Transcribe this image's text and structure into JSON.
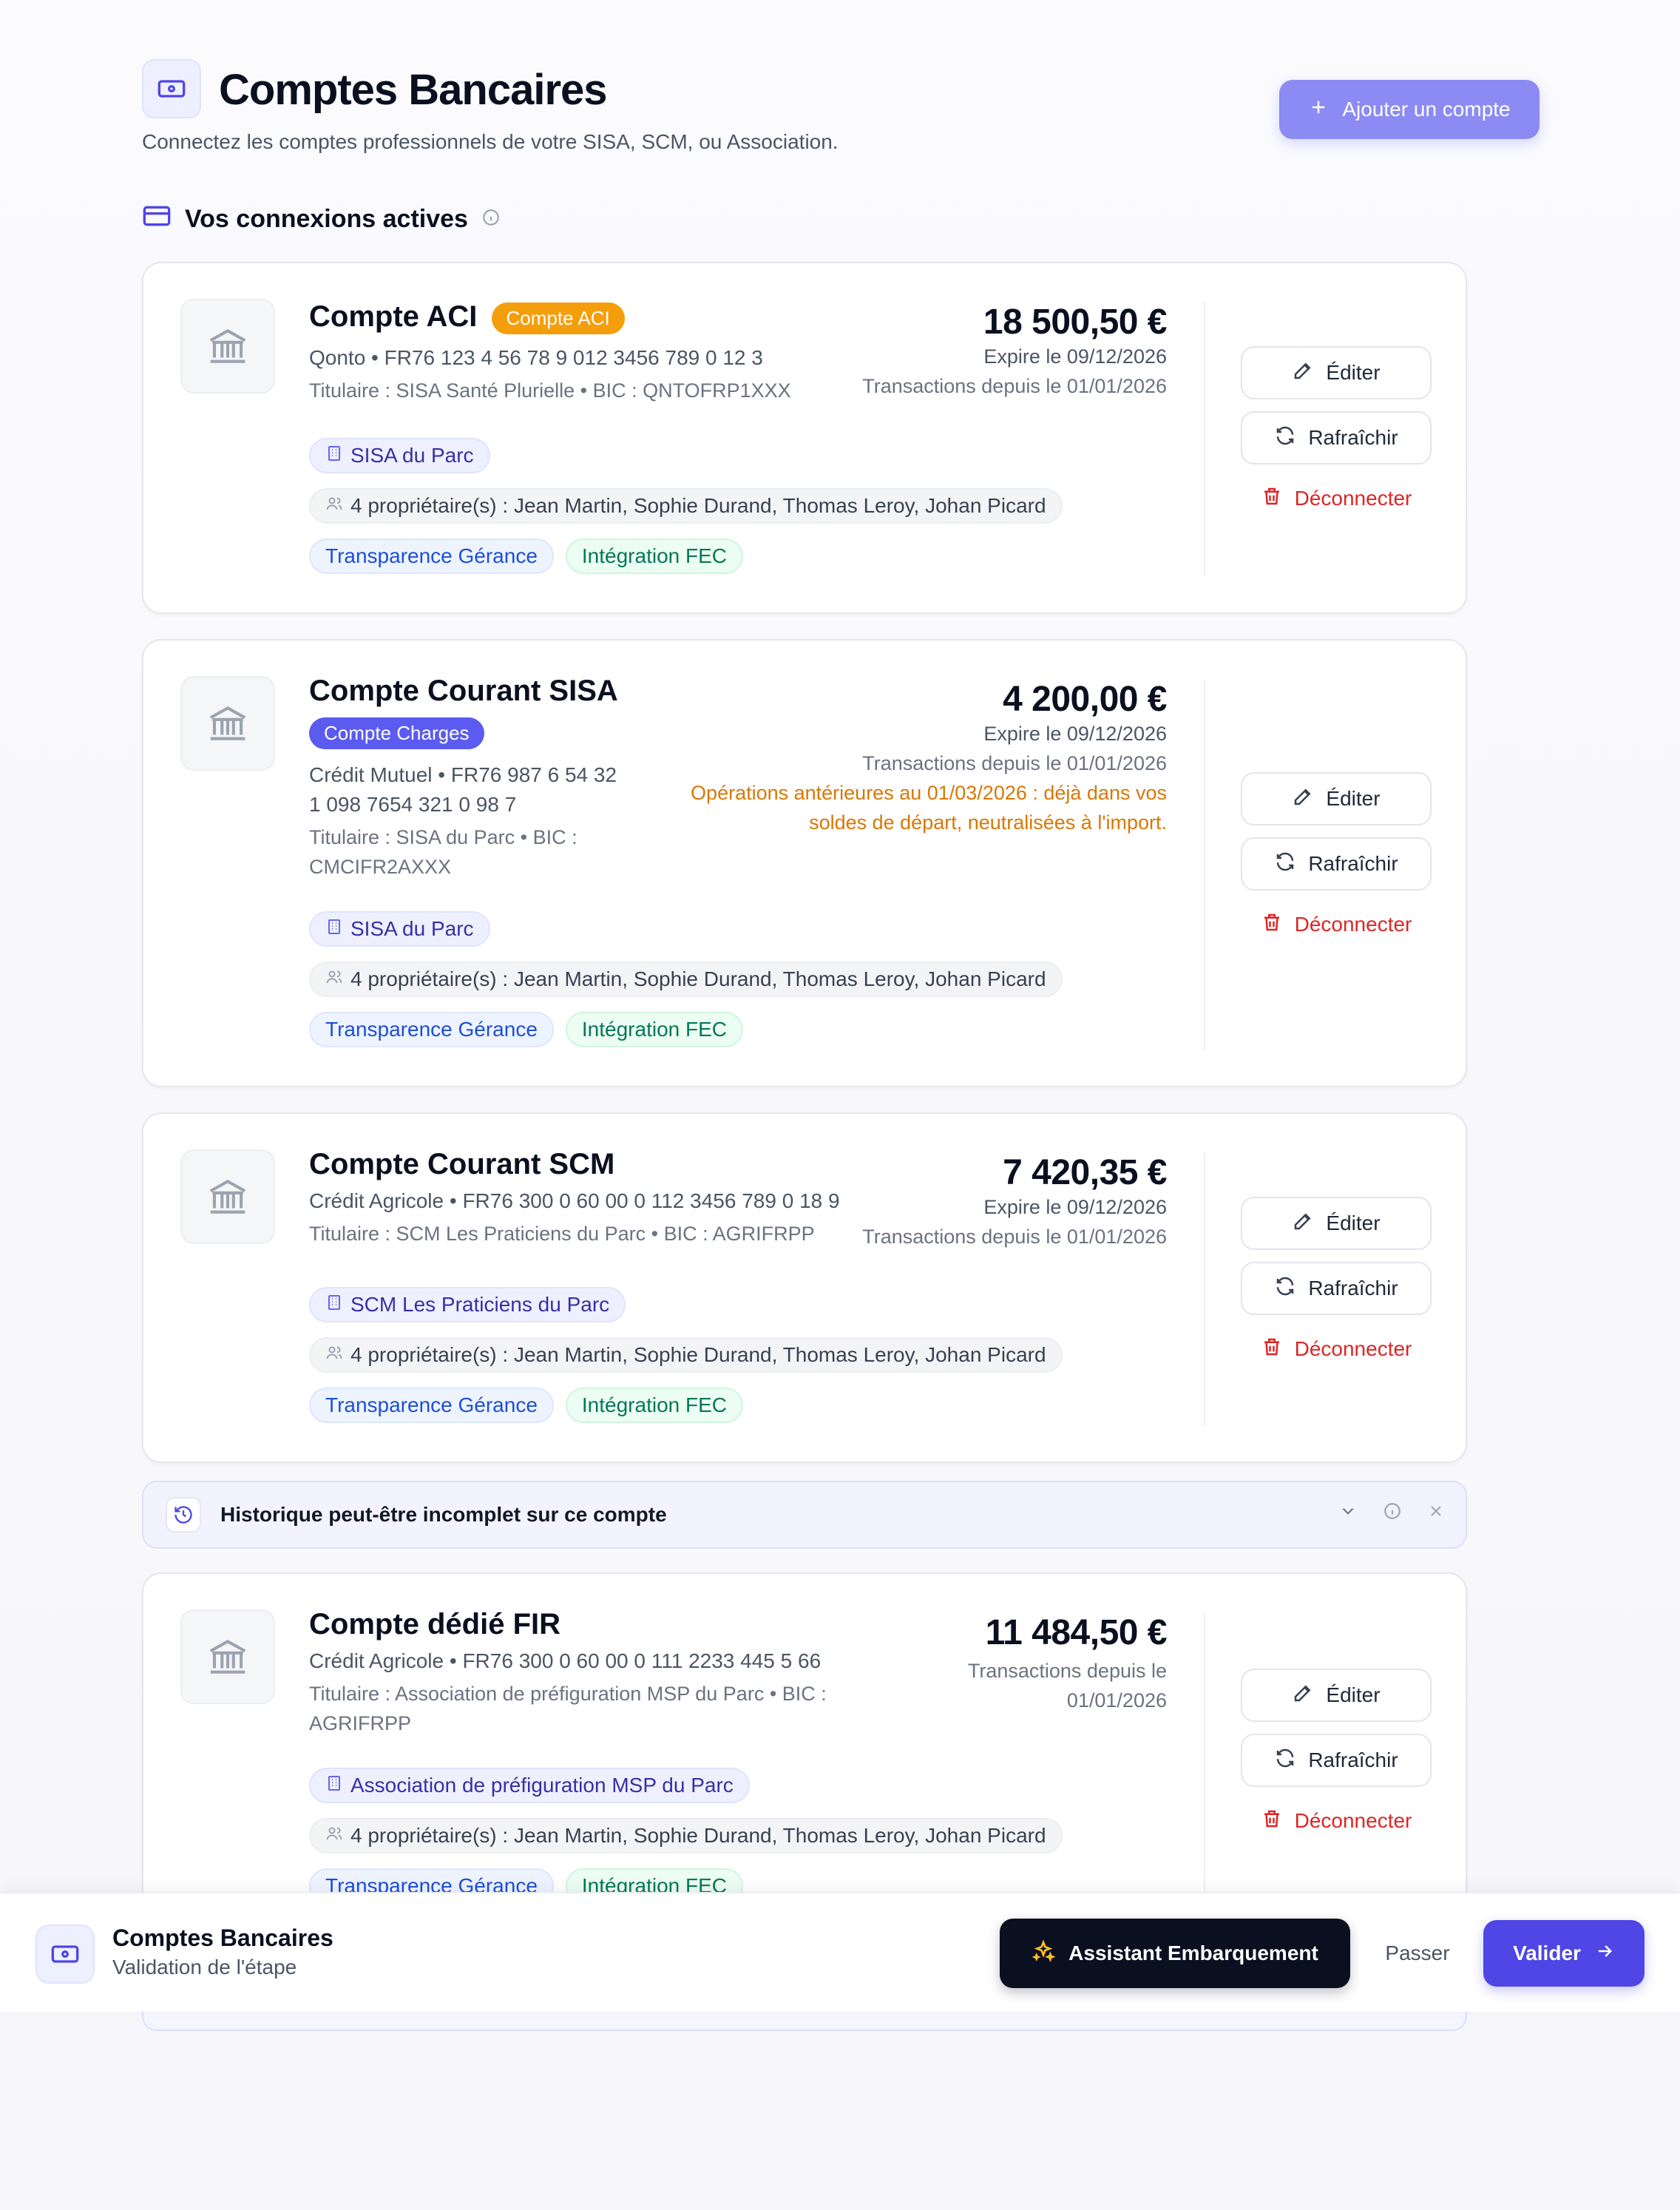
{
  "header": {
    "title": "Comptes Bancaires",
    "subtitle": "Connectez les comptes professionnels de votre SISA, SCM, ou Association.",
    "add_button": "Ajouter un compte"
  },
  "section": {
    "title": "Vos connexions actives"
  },
  "actions": {
    "edit": "Éditer",
    "refresh": "Rafraîchir",
    "disconnect": "Déconnecter"
  },
  "accounts": [
    {
      "name": "Compte ACI",
      "badge": "Compte ACI",
      "bank_line": "Qonto • FR76 123 4 56 78 9 012 3456 789 0 12 3",
      "holder_line": "Titulaire : SISA Santé Plurielle • BIC : QNTOFRP1XXX",
      "balance": "18 500,50 €",
      "expires": "Expire le 09/12/2026",
      "since": "Transactions depuis le 01/01/2026",
      "entity": "SISA du Parc",
      "owners": "4 propriétaire(s) : Jean Martin, Sophie Durand, Thomas Leroy, Johan Picard",
      "tag_blue": "Transparence Gérance",
      "tag_green": "Intégration FEC"
    },
    {
      "name": "Compte Courant SISA",
      "badge": "Compte Charges",
      "bank_line_1": "Crédit Mutuel • FR76 987 6 54 32",
      "bank_line_2": "1 098 7654 321 0 98 7",
      "holder_line_1": "Titulaire : SISA du Parc • BIC :",
      "holder_line_2": "CMCIFR2AXXX",
      "balance": "4 200,00 €",
      "expires": "Expire le 09/12/2026",
      "since": "Transactions depuis le 01/01/2026",
      "warning_1": "Opérations antérieures au 01/03/2026 : déjà dans vos",
      "warning_2": "soldes de départ, neutralisées à l'import.",
      "entity": "SISA du Parc",
      "owners": "4 propriétaire(s) : Jean Martin, Sophie Durand, Thomas Leroy, Johan Picard",
      "tag_blue": "Transparence Gérance",
      "tag_green": "Intégration FEC"
    },
    {
      "name": "Compte Courant SCM",
      "bank_line": "Crédit Agricole • FR76 300 0 60 00 0 112 3456 789 0 18 9",
      "holder_line": "Titulaire : SCM Les Praticiens du Parc • BIC : AGRIFRPP",
      "balance": "7 420,35 €",
      "expires": "Expire le 09/12/2026",
      "since": "Transactions depuis le 01/01/2026",
      "entity": "SCM Les Praticiens du Parc",
      "owners": "4 propriétaire(s) : Jean Martin, Sophie Durand, Thomas Leroy, Johan Picard",
      "tag_blue": "Transparence Gérance",
      "tag_green": "Intégration FEC"
    },
    {
      "name": "Compte dédié FIR",
      "bank_line": "Crédit Agricole • FR76 300 0 60 00 0 111 2233 445 5 66",
      "holder_line_1": "Titulaire : Association de préfiguration MSP du Parc • BIC :",
      "holder_line_2": "AGRIFRPP",
      "balance": "11 484,50 €",
      "since_1": "Transactions depuis le",
      "since_2": "01/01/2026",
      "entity": "Association de préfiguration MSP du Parc",
      "owners": "4 propriétaire(s) : Jean Martin, Sophie Durand, Thomas Leroy, Johan Picard",
      "tag_blue": "Transparence Gérance",
      "tag_green": "Intégration FEC"
    }
  ],
  "history_banner": {
    "text": "Historique peut-être incomplet sur ce compte"
  },
  "footer": {
    "title": "Comptes Bancaires",
    "subtitle": "Validation de l'étape",
    "assistant": "Assistant Embarquement",
    "skip": "Passer",
    "validate": "Valider"
  },
  "colors": {
    "accent": "#4f46e5",
    "accent_light": "#8b8bf3",
    "warning": "#d97706",
    "danger": "#dc2626",
    "badge_orange": "#f59e0b"
  }
}
